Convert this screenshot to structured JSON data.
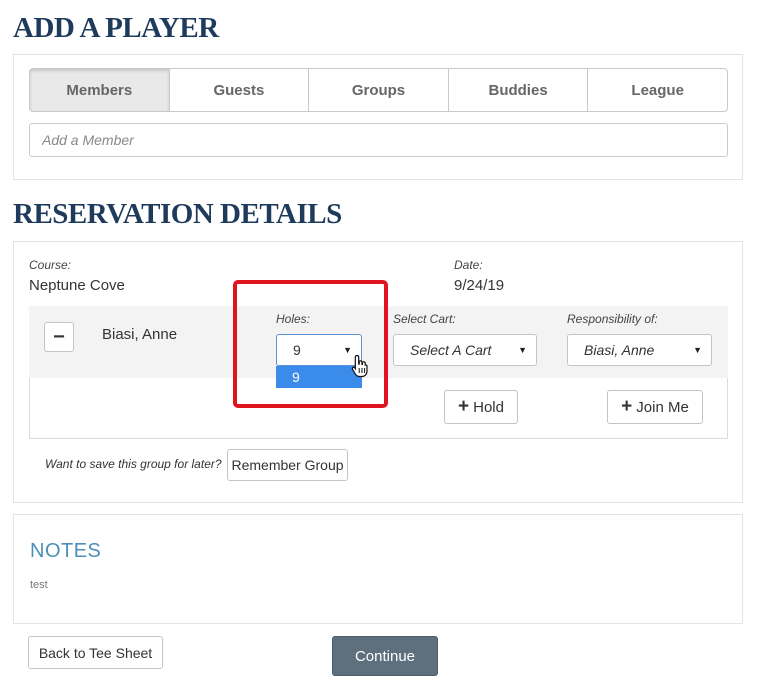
{
  "add_player": {
    "title": "ADD A PLAYER",
    "tabs": [
      {
        "label": "Members",
        "active": true
      },
      {
        "label": "Guests",
        "active": false
      },
      {
        "label": "Groups",
        "active": false
      },
      {
        "label": "Buddies",
        "active": false
      },
      {
        "label": "League",
        "active": false
      }
    ],
    "search_placeholder": "Add a Member"
  },
  "reservation": {
    "title": "RESERVATION DETAILS",
    "course_label": "Course:",
    "course_value": "Neptune Cove",
    "date_label": "Date:",
    "date_value": "9/24/19",
    "player": {
      "remove_label": "−",
      "name": "Biasi, Anne",
      "holes_label": "Holes:",
      "holes_value": "9",
      "holes_options": [
        "9"
      ],
      "cart_label": "Select Cart:",
      "cart_value": "Select A Cart",
      "responsibility_label": "Responsibility of:",
      "responsibility_value": "Biasi, Anne"
    },
    "hold_label": "Hold",
    "join_label": "Join Me",
    "save_prompt": "Want to save this group for later?",
    "remember_label": "Remember Group"
  },
  "notes": {
    "title": "NOTES",
    "text": "test"
  },
  "footer": {
    "back_label": "Back to Tee Sheet",
    "continue_label": "Continue"
  },
  "colors": {
    "title": "#1f3b5c",
    "notes_title": "#4c8fb8",
    "highlight": "#e0141e",
    "selected_option": "#3a8bea",
    "continue_bg": "#5e6f7e"
  },
  "icons": {
    "caret": "caret-down-icon",
    "plus": "plus-icon",
    "cursor": "hand-pointer-icon"
  }
}
